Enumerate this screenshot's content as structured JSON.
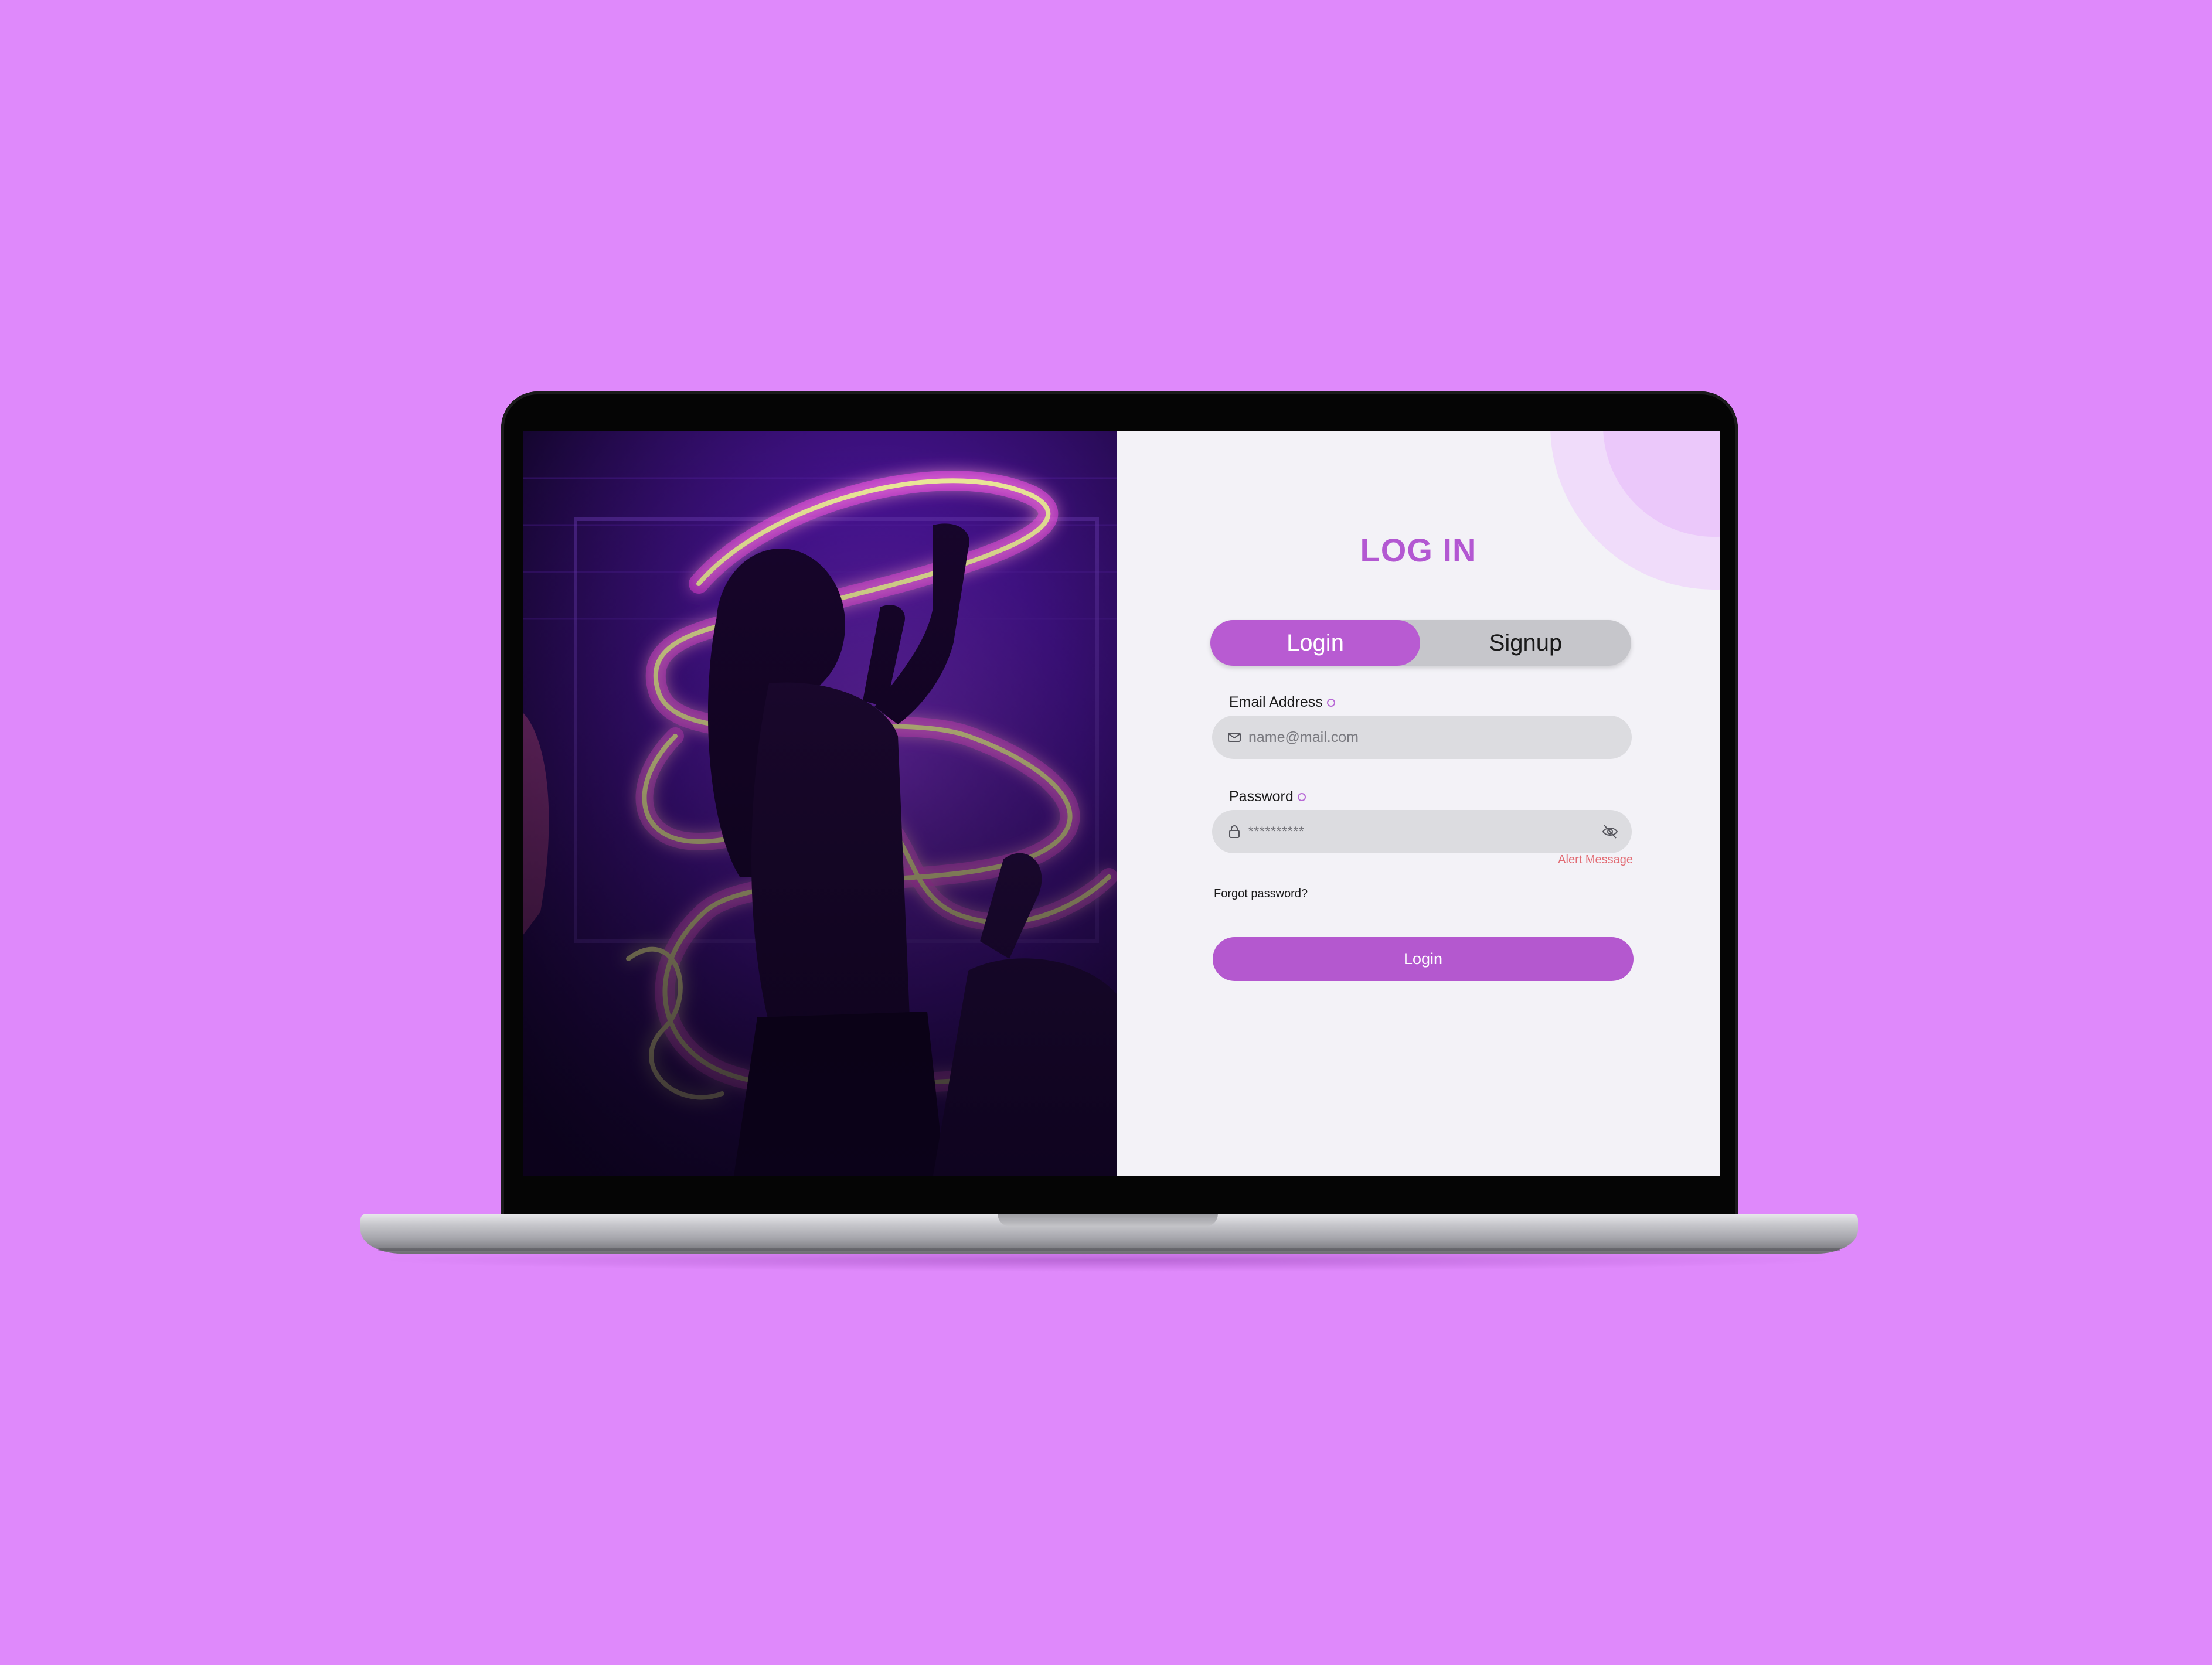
{
  "login_panel": {
    "title": "LOG IN",
    "tabs": [
      {
        "label": "Login",
        "active": true
      },
      {
        "label": "Signup",
        "active": false
      }
    ],
    "email_field": {
      "label": "Email Address",
      "placeholder": "name@mail.com",
      "icon": "mail-icon"
    },
    "password_field": {
      "label": "Password",
      "value_masked": "**********",
      "icon": "lock-icon",
      "toggle_icon": "eye-off-icon",
      "alert": "Alert Message"
    },
    "forgot_password": "Forgot password?",
    "submit_label": "Login"
  },
  "colors": {
    "background": "#df89fb",
    "accent": "#b85bd2",
    "panel": "#f3f2f7",
    "input": "#dcdce0",
    "alert": "#e26b73",
    "tab_track": "#c6c6cb"
  }
}
